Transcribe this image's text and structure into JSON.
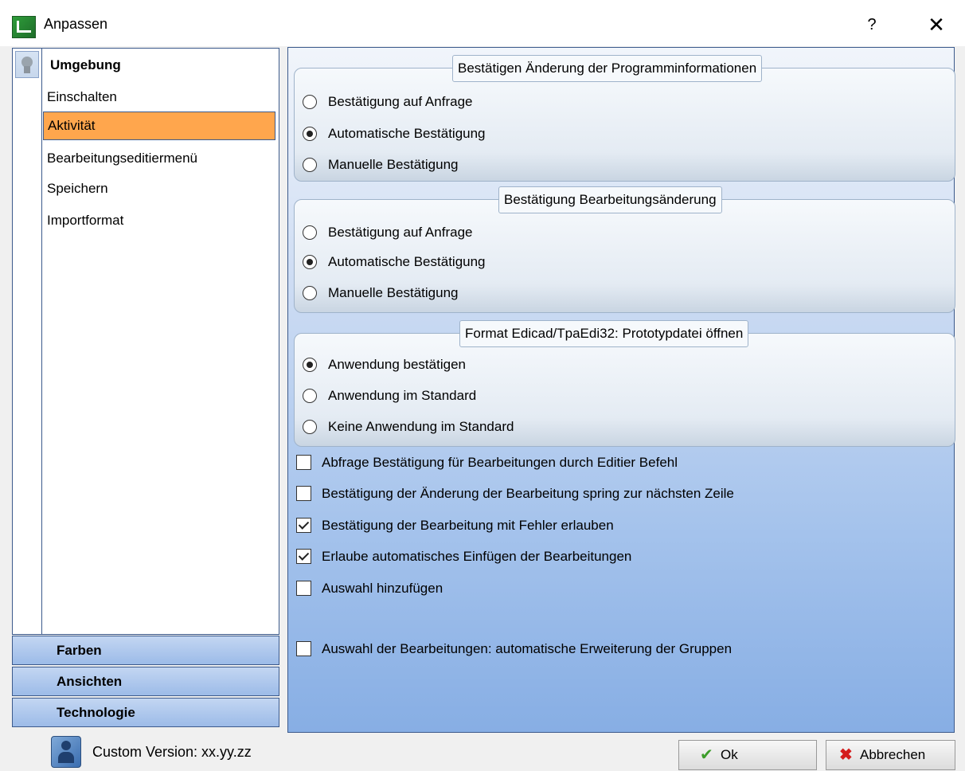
{
  "window": {
    "title": "Anpassen",
    "help_label": "?",
    "close_label": "✕"
  },
  "sidebar": {
    "group_title": "Umgebung",
    "items": [
      {
        "label": "Einschalten",
        "selected": false
      },
      {
        "label": "Aktivität",
        "selected": true
      },
      {
        "label": "Bearbeitungseditiermenü",
        "selected": false
      },
      {
        "label": "Speichern",
        "selected": false
      },
      {
        "label": "Importformat",
        "selected": false
      }
    ],
    "categories": [
      "Farben",
      "Ansichten",
      "Technologie"
    ]
  },
  "main": {
    "groups": [
      {
        "title": "Bestätigen Änderung der Programminformationen",
        "options": [
          {
            "label": "Bestätigung auf Anfrage",
            "checked": false
          },
          {
            "label": "Automatische Bestätigung",
            "checked": true
          },
          {
            "label": "Manuelle Bestätigung",
            "checked": false
          }
        ]
      },
      {
        "title": "Bestätigung Bearbeitungsänderung",
        "options": [
          {
            "label": "Bestätigung auf Anfrage",
            "checked": false
          },
          {
            "label": "Automatische Bestätigung",
            "checked": true
          },
          {
            "label": "Manuelle Bestätigung",
            "checked": false
          }
        ]
      },
      {
        "title": "Format Edicad/TpaEdi32: Prototypdatei öffnen",
        "options": [
          {
            "label": "Anwendung bestätigen",
            "checked": true
          },
          {
            "label": "Anwendung im Standard",
            "checked": false
          },
          {
            "label": "Keine Anwendung im Standard",
            "checked": false
          }
        ]
      }
    ],
    "checkboxes": [
      {
        "label": "Abfrage Bestätigung für Bearbeitungen durch Editier Befehl",
        "checked": false
      },
      {
        "label": "Bestätigung der Änderung der Bearbeitung spring zur nächsten Zeile",
        "checked": false
      },
      {
        "label": "Bestätigung der Bearbeitung mit Fehler erlauben",
        "checked": true
      },
      {
        "label": "Erlaube automatisches Einfügen der Bearbeitungen",
        "checked": true
      },
      {
        "label": "Auswahl hinzufügen",
        "checked": false
      },
      {
        "label": "Auswahl der Bearbeitungen: automatische Erweiterung der Gruppen",
        "checked": false
      }
    ]
  },
  "footer": {
    "version_text": "Custom Version: xx.yy.zz",
    "ok_label": "Ok",
    "cancel_label": "Abbrechen"
  }
}
